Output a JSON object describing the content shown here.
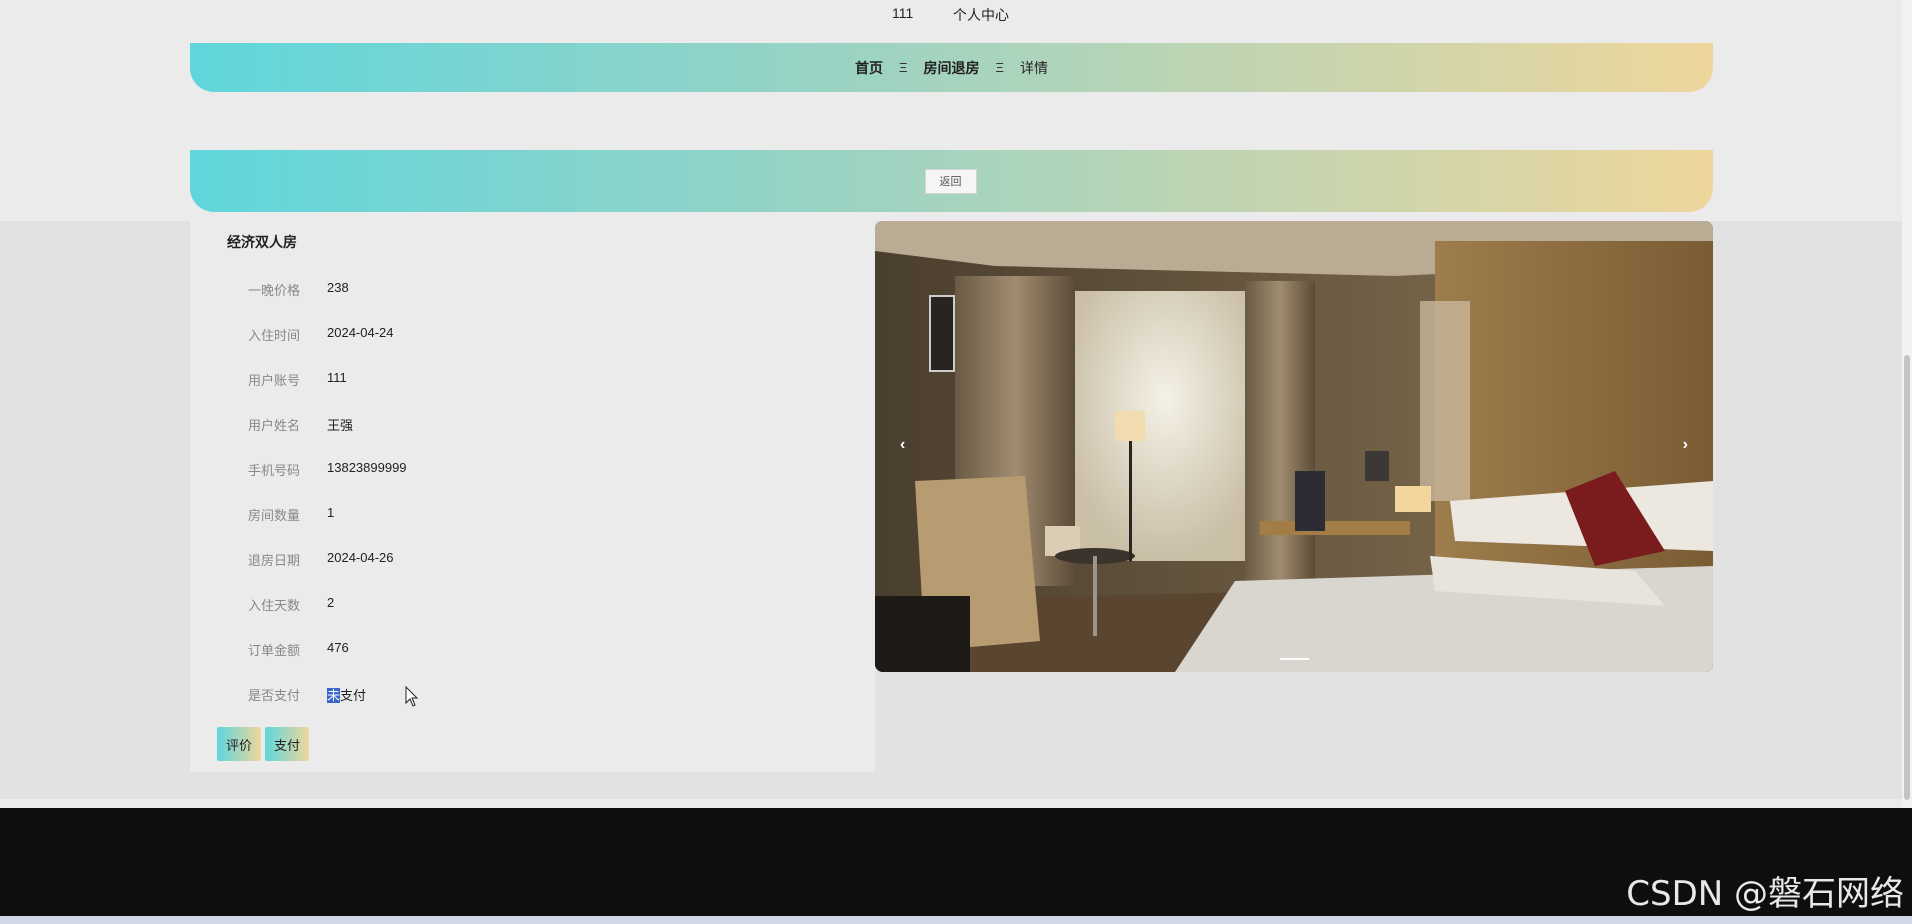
{
  "topbar": {
    "username": "111",
    "personal_center": "个人中心"
  },
  "breadcrumb": {
    "items": [
      "首页",
      "房间退房",
      "详情"
    ],
    "separator": "Ξ"
  },
  "actions": {
    "back_label": "返回"
  },
  "room": {
    "title": "经济双人房",
    "fields": [
      {
        "label": "一晚价格",
        "value": "238"
      },
      {
        "label": "入住时间",
        "value": "2024-04-24"
      },
      {
        "label": "用户账号",
        "value": "111"
      },
      {
        "label": "用户姓名",
        "value": "王强"
      },
      {
        "label": "手机号码",
        "value": "13823899999"
      },
      {
        "label": "房间数量",
        "value": "1"
      },
      {
        "label": "退房日期",
        "value": "2024-04-26"
      },
      {
        "label": "入住天数",
        "value": "2"
      },
      {
        "label": "订单金额",
        "value": "476"
      },
      {
        "label": "是否支付",
        "value_highlighted": "未",
        "value_rest": "支付"
      }
    ],
    "buttons": {
      "review": "评价",
      "pay": "支付"
    }
  },
  "carousel": {
    "prev": "‹",
    "next": "›"
  },
  "watermark": "CSDN @磐石网络",
  "colors": {
    "gradient_start": "#5fd6dc",
    "gradient_end": "#eed69c",
    "footer": "#0e0e0e"
  }
}
